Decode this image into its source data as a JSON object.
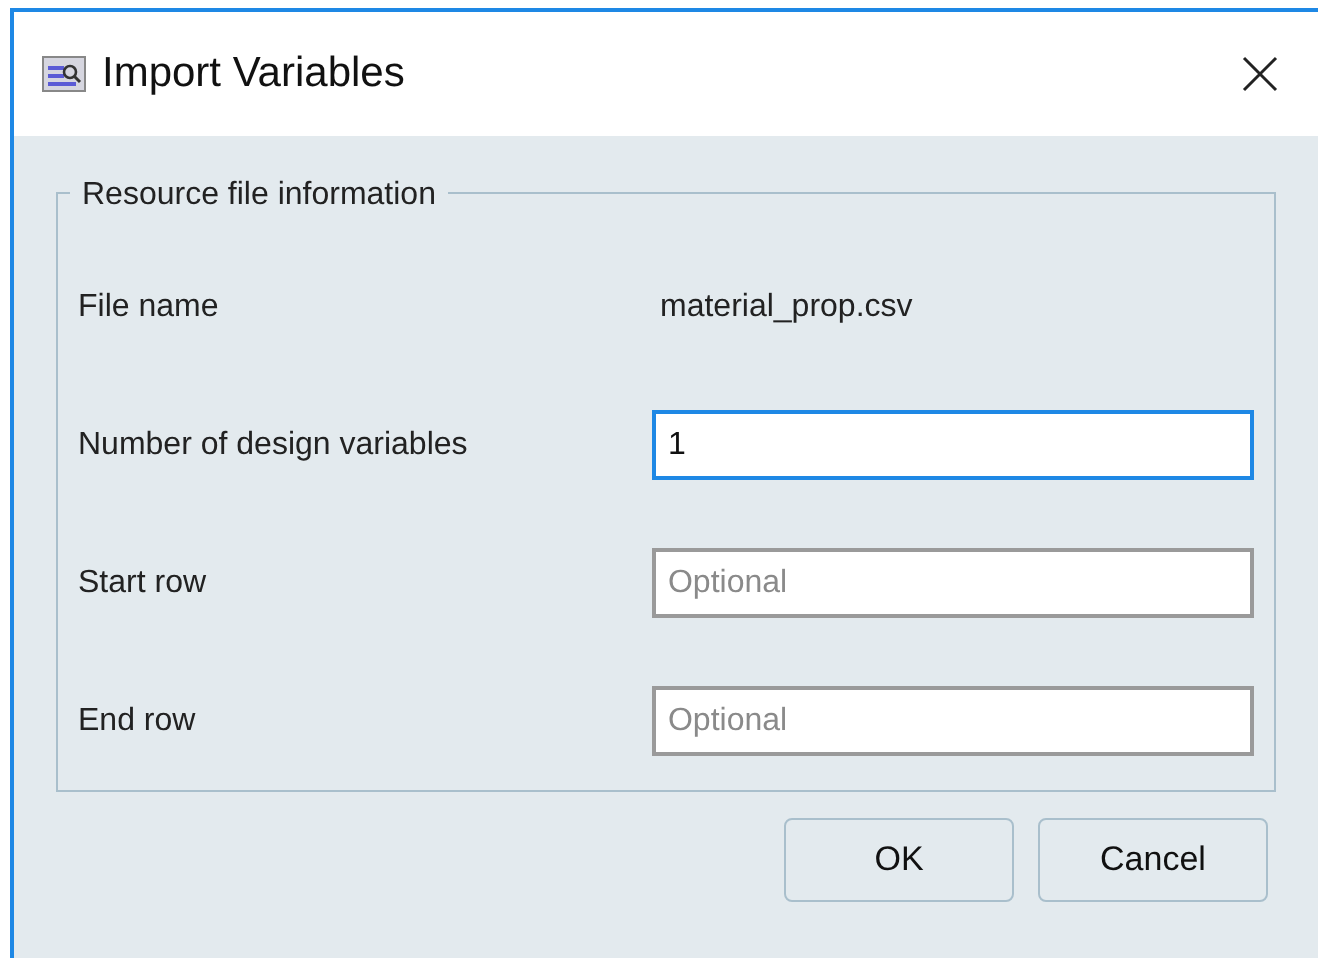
{
  "window": {
    "title": "Import Variables"
  },
  "group": {
    "title": "Resource file information",
    "rows": [
      {
        "kind": "text",
        "label": "File name",
        "value": "material_prop.csv"
      },
      {
        "kind": "field",
        "label": "Number of design variables",
        "value": "1",
        "focused": true
      },
      {
        "kind": "field",
        "label": "Start row",
        "placeholder": "Optional",
        "focused": false
      },
      {
        "kind": "field",
        "label": "End row",
        "placeholder": "Optional",
        "focused": false
      }
    ]
  },
  "buttons": [
    "OK",
    "Cancel"
  ]
}
